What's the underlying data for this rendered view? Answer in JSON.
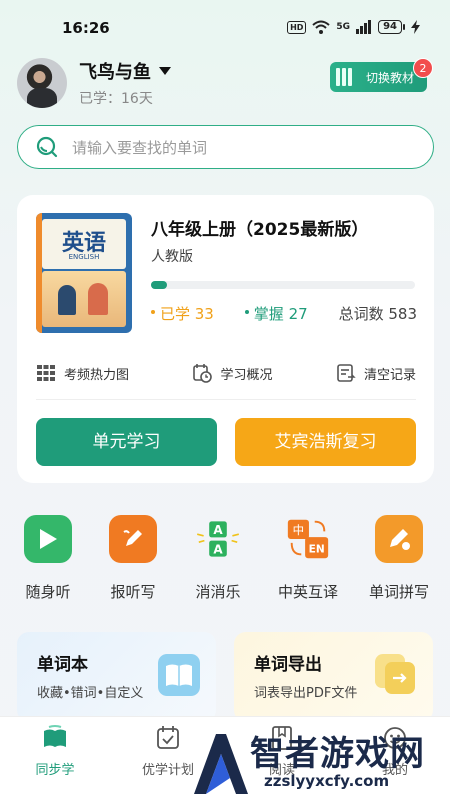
{
  "status_bar": {
    "time": "16:26",
    "hd": "HD",
    "network": "5G",
    "battery": "94"
  },
  "header": {
    "username": "飞鸟与鱼",
    "learned_days": "已学：16天",
    "switch_book_label": "切换教材",
    "switch_badge": "2"
  },
  "search": {
    "placeholder": "请输入要查找的单词"
  },
  "book": {
    "cover_title": "英语",
    "cover_subtitle": "ENGLISH",
    "title": "八年级上册（2025最新版）",
    "publisher": "人教版",
    "progress_fraction": 0.06,
    "learned_label": "已学 33",
    "mastered_label": "掌握 27",
    "total_label": "总词数 583",
    "tools": [
      {
        "label": "考频热力图",
        "icon": "grid-icon"
      },
      {
        "label": "学习概况",
        "icon": "calendar-clock-icon"
      },
      {
        "label": "清空记录",
        "icon": "clear-record-icon"
      }
    ],
    "unit_study_label": "单元学习",
    "review_label": "艾宾浩斯复习"
  },
  "features": [
    {
      "label": "随身听",
      "icon": "play-icon",
      "color": "#34b76a"
    },
    {
      "label": "报听写",
      "icon": "pencil-icon",
      "color": "#f07a22"
    },
    {
      "label": "消消乐",
      "icon": "letter-a-icon",
      "color": "#2db15e"
    },
    {
      "label": "中英互译",
      "icon": "translate-icon",
      "color": "#f07a22"
    },
    {
      "label": "单词拼写",
      "icon": "spell-pencil-icon",
      "color": "#f39a2a"
    }
  ],
  "cards": {
    "wordbook": {
      "title": "单词本",
      "subtitle": "收藏•错词•自定义"
    },
    "export": {
      "title": "单词导出",
      "subtitle": "词表导出PDF文件"
    }
  },
  "nav": [
    {
      "label": "同步学",
      "active": true
    },
    {
      "label": "优学计划",
      "active": false
    },
    {
      "label": "阅读",
      "active": false
    },
    {
      "label": "我的",
      "active": false
    }
  ],
  "watermark": {
    "brand": "智者游戏网",
    "url": "zzslyyxcfy.com"
  },
  "colors": {
    "primary": "#1f9c7a",
    "accent": "#f6a717",
    "badge": "#f24d4d"
  }
}
